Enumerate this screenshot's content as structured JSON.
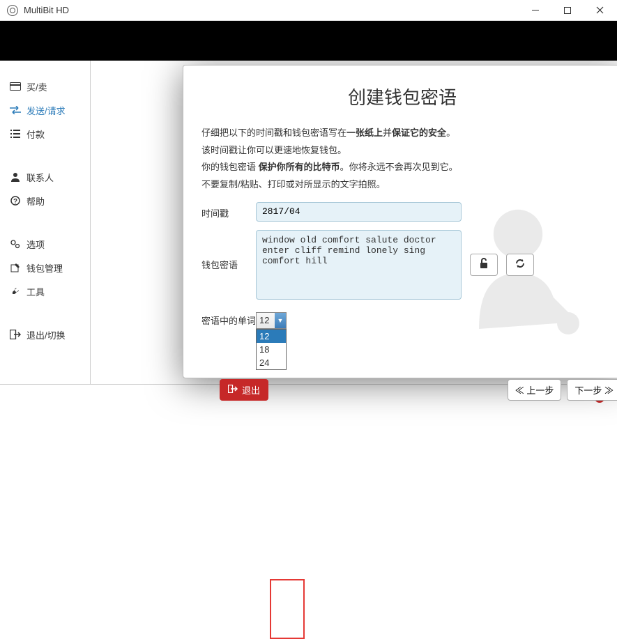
{
  "window": {
    "title": "MultiBit HD"
  },
  "sidebar": {
    "items": [
      {
        "label": "买/卖"
      },
      {
        "label": "发送/请求"
      },
      {
        "label": "付款"
      },
      {
        "label": "联系人"
      },
      {
        "label": "帮助"
      },
      {
        "label": "选项"
      },
      {
        "label": "钱包管理"
      },
      {
        "label": "工具"
      },
      {
        "label": "退出/切换"
      }
    ]
  },
  "modal": {
    "title": "创建钱包密语",
    "instr1_a": "仔细把以下的时间戳和钱包密语写在",
    "instr1_b": "一张纸上",
    "instr1_c": "并",
    "instr1_d": "保证它的安全",
    "instr1_e": "。",
    "instr2": "该时间戳让你可以更速地恢复钱包。",
    "instr3_a": "你的钱包密语 ",
    "instr3_b": "保护你所有的比特币",
    "instr3_c": "。你将永远不会再次见到它。",
    "instr4": "不要复制/粘贴、打印或对所显示的文字拍照。",
    "timestamp_label": "时间戳",
    "timestamp_value": "2817/04",
    "seed_label": "钱包密语",
    "seed_value": "window old comfort salute doctor\nenter cliff remind lonely sing\ncomfort hill",
    "wordcount_label": "密语中的单词",
    "select_value": "12",
    "options": [
      "12",
      "18",
      "24"
    ],
    "exit_label": "退出",
    "prev_label": "上一步",
    "next_label": "下一步"
  }
}
